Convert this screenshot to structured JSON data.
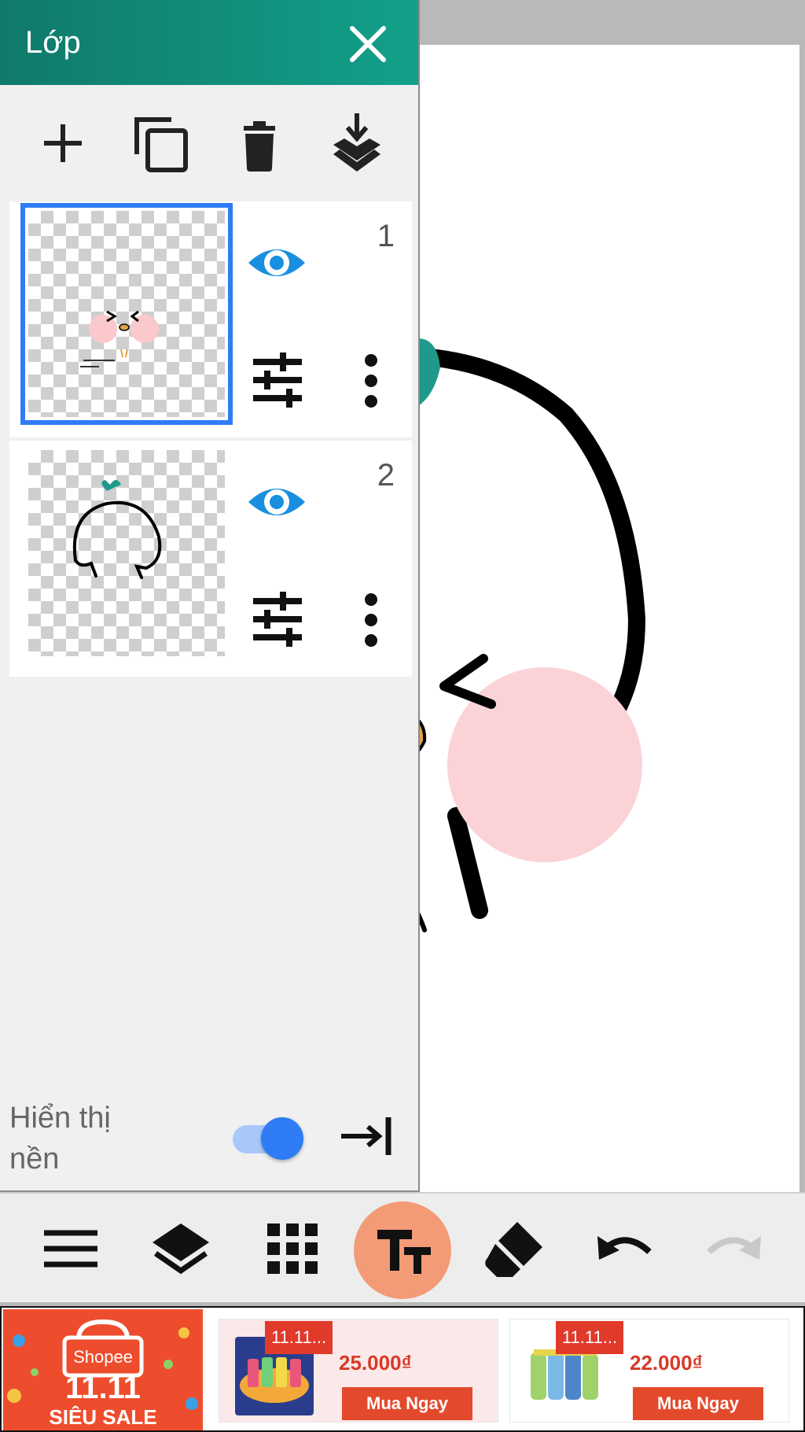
{
  "panel": {
    "title": "Lớp",
    "layers": [
      {
        "number": "1",
        "visible": true,
        "selected": true
      },
      {
        "number": "2",
        "visible": true,
        "selected": false
      }
    ],
    "background_label": "Hiển thị nền",
    "background_toggle_on": true
  },
  "colors": {
    "header_start": "#107a6a",
    "header_end": "#13a08a",
    "accent_blue": "#2f7cf6",
    "text_tool": "#f39b76",
    "shopee_orange": "#ee4d2d"
  },
  "icons": {
    "toolbar": [
      "add-icon",
      "duplicate-icon",
      "delete-icon",
      "merge-down-icon"
    ],
    "bottom": [
      "menu-icon",
      "layers-icon",
      "grid-icon",
      "text-icon",
      "eraser-icon",
      "undo-icon",
      "redo-icon"
    ]
  },
  "ad": {
    "logo_brand": "Shopee",
    "logo_event": "11.11",
    "logo_sale": "SIÊU SALE",
    "products": [
      {
        "tag": "11.11...",
        "price": "25.000₫",
        "button": "Mua Ngay"
      },
      {
        "tag": "11.11...",
        "price": "22.000₫",
        "button": "Mua Ngay"
      }
    ]
  }
}
